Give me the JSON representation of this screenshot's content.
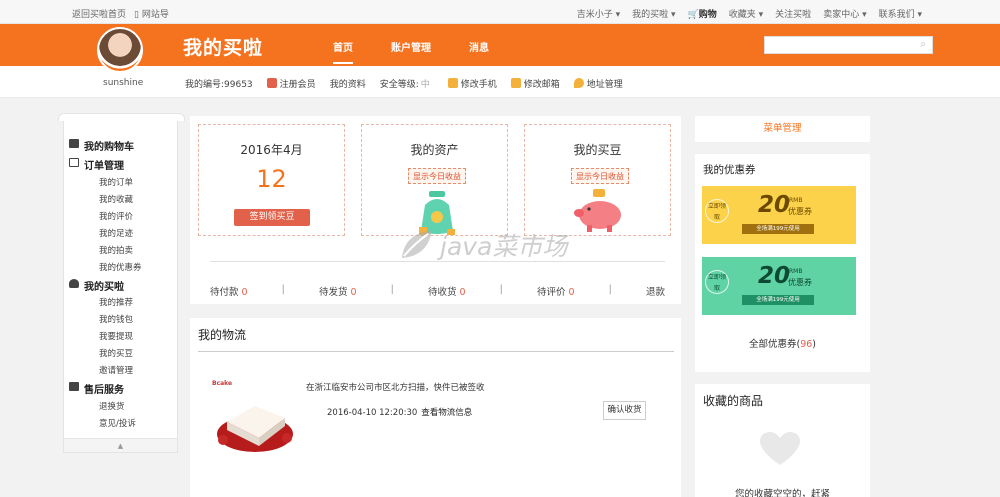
{
  "topbar": {
    "left": [
      "返回买啦首页",
      "网站导"
    ],
    "right": [
      "吉米小子",
      "我的买啦",
      "购物",
      "收藏夹",
      "关注买啦",
      "卖家中心",
      "联系我们"
    ]
  },
  "header": {
    "brand": "我的买啦",
    "nav": [
      "首页",
      "账户管理",
      "消息"
    ],
    "search_placeholder": ""
  },
  "user": {
    "name": "sunshine",
    "id_label": "我的编号:99653",
    "items": [
      "注册会员",
      "我的资料",
      "安全等级:",
      "修改手机",
      "修改邮箱",
      "地址管理"
    ],
    "security_level": "中"
  },
  "sidebar": {
    "groups": [
      {
        "label": "我的购物车",
        "items": []
      },
      {
        "label": "订单管理",
        "items": [
          "我的订单",
          "我的收藏",
          "我的评价",
          "我的足迹",
          "我的拍卖",
          "我的优惠券"
        ]
      },
      {
        "label": "我的买啦",
        "items": [
          "我的推荐",
          "我的钱包",
          "我要提现",
          "我的买豆",
          "邀请管理"
        ]
      },
      {
        "label": "售后服务",
        "items": [
          "退换货",
          "意见/投诉"
        ]
      }
    ],
    "scroll_glyph": "▲"
  },
  "cards": {
    "date": {
      "title": "2016年4月",
      "value": "12",
      "button": "签到领买豆"
    },
    "assets": {
      "title": "我的资产",
      "tag": "显示今日收益"
    },
    "beans": {
      "title": "我的买豆",
      "tag": "显示今日收益"
    }
  },
  "order_status": [
    {
      "label": "待付款",
      "count": "0"
    },
    {
      "label": "待发货",
      "count": "0"
    },
    {
      "label": "待收货",
      "count": "0"
    },
    {
      "label": "待评价",
      "count": "0"
    },
    {
      "label": "退款",
      "count": ""
    }
  ],
  "status_sep": "|",
  "logistics": {
    "title": "我的物流",
    "shop_logo": "Bcake",
    "message": "在浙江临安市公司市区北方扫描，快件已被签收",
    "time": "2016-04-10 12:20:30",
    "detail_link": "查看物流信息",
    "confirm_button": "确认收货"
  },
  "right": {
    "menu_manage": "菜单管理",
    "coupons_title": "我的优惠券",
    "coupons": [
      {
        "badge": "立即领取",
        "amount": "20",
        "currency": "RMB",
        "label": "优惠券",
        "condition": "全场满199元使用",
        "color": "#fbd249",
        "text_color": "#6b4a00",
        "cond_bg": "#a0700e"
      },
      {
        "badge": "立即领取",
        "amount": "20",
        "currency": "RMB",
        "label": "优惠券",
        "condition": "全场满199元使用",
        "color": "#5fd3a4",
        "text_color": "#0e4a33",
        "cond_bg": "#1f8f66"
      }
    ],
    "all_coupons_label": "全部优惠券(",
    "all_coupons_count": "96",
    "all_coupons_close": ")",
    "favs_title": "收藏的商品",
    "favs_empty": "您的收藏空空的，赶紧"
  },
  "watermark": "java菜市场",
  "colors": {
    "accent": "#f5731f",
    "red": "#e1614a"
  }
}
